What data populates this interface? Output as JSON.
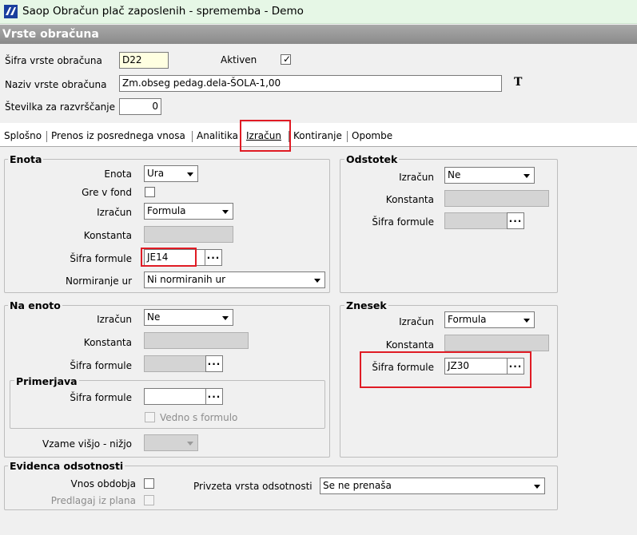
{
  "window": {
    "title": "Saop Obračun plač zaposlenih - sprememba - Demo"
  },
  "section_title": "Vrste obračuna",
  "header": {
    "sifra_label": "Šifra vrste obračuna",
    "sifra_value": "D22",
    "aktiven_label": "Aktiven",
    "aktiven_checked": true,
    "naziv_label": "Naziv vrste obračuna",
    "naziv_value": "Zm.obseg pedag.dela-ŠOLA-1,00",
    "stevilka_label": "Številka  za razvrščanje",
    "stevilka_value": "0",
    "font_icon": "T"
  },
  "tabs": [
    {
      "label": "Splošno"
    },
    {
      "label": "Prenos iz posrednega vnosa"
    },
    {
      "label": "Analitika"
    },
    {
      "label": "Izračun",
      "active": true
    },
    {
      "label": "Kontiranje"
    },
    {
      "label": "Opombe"
    }
  ],
  "enota": {
    "title": "Enota",
    "enota_label": "Enota",
    "enota_value": "Ura",
    "gre_v_fond_label": "Gre v fond",
    "izracun_label": "Izračun",
    "izracun_value": "Formula",
    "konstanta_label": "Konstanta",
    "sifra_formule_label": "Šifra formule",
    "sifra_formule_value": "JE14",
    "normiranje_label": "Normiranje ur",
    "normiranje_value": "Ni normiranih ur",
    "browse": "..."
  },
  "odstotek": {
    "title": "Odstotek",
    "izracun_label": "Izračun",
    "izracun_value": "Ne",
    "konstanta_label": "Konstanta",
    "sifra_formule_label": "Šifra formule",
    "browse": "..."
  },
  "na_enoto": {
    "title": "Na enoto",
    "izracun_label": "Izračun",
    "izracun_value": "Ne",
    "konstanta_label": "Konstanta",
    "sifra_formule_label": "Šifra formule",
    "browse": "...",
    "primerjava": {
      "title": "Primerjava",
      "sifra_formule_label": "Šifra formule",
      "vedno_label": "Vedno s formulo",
      "browse": "..."
    },
    "vzame_label": "Vzame višjo - nižjo"
  },
  "znesek": {
    "title": "Znesek",
    "izracun_label": "Izračun",
    "izracun_value": "Formula",
    "konstanta_label": "Konstanta",
    "sifra_formule_label": "Šifra formule",
    "sifra_formule_value": "JZ30",
    "browse": "..."
  },
  "evidenca": {
    "title": "Evidenca odsotnosti",
    "vnos_obdobja_label": "Vnos obdobja",
    "predlagaj_label": "Predlagaj iz plana",
    "privzeta_label": "Privzeta vrsta odsotnosti",
    "privzeta_value": "Se ne prenaša"
  },
  "colors": {
    "highlight": "#e01b24",
    "readonly": "#d4d4d4",
    "required": "#ffffe1"
  }
}
